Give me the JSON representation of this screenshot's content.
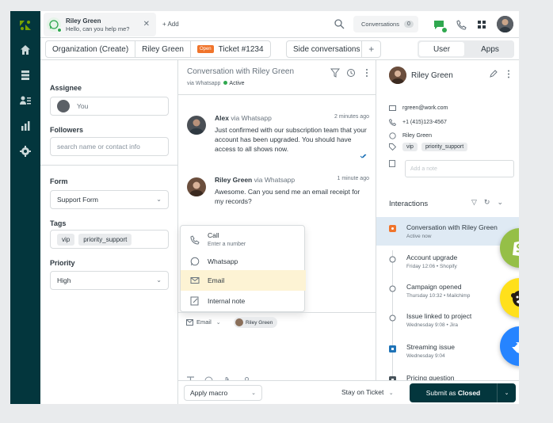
{
  "nav": {
    "items": [
      "home-icon",
      "views-icon",
      "customers-icon",
      "reporting-icon",
      "settings-icon"
    ]
  },
  "topbar": {
    "tab": {
      "name": "Riley Green",
      "preview": "Hello, can you help me?"
    },
    "add_label": "+ Add",
    "conversations_label": "Conversations",
    "conversations_count": "0"
  },
  "row2": {
    "org": "Organization (Create)",
    "requester": "Riley Green",
    "status_badge": "Open",
    "ticket": "Ticket #1234",
    "side_conversations": "Side conversations",
    "plus": "+",
    "user_tab": "User",
    "apps_tab": "Apps"
  },
  "left": {
    "assignee_label": "Assignee",
    "assignee_value": "You",
    "followers_label": "Followers",
    "followers_placeholder": "search name or contact info",
    "form_label": "Form",
    "form_value": "Support Form",
    "tags_label": "Tags",
    "tags": [
      "vip",
      "priority_support"
    ],
    "priority_label": "Priority",
    "priority_value": "High"
  },
  "conversation": {
    "title": "Conversation with Riley Green",
    "via": "via Whatsapp",
    "status": "Active",
    "messages": [
      {
        "name": "Alex",
        "via": "via Whatsapp",
        "time": "2 minutes ago",
        "body": "Just confirmed with our subscription team that your account has been upgraded. You should have access to all shows now."
      },
      {
        "name": "Riley Green",
        "via": "via Whatsapp",
        "time": "1 minute ago",
        "body": "Awesome. Can you send me an email receipt for my records?"
      }
    ],
    "channel_menu": [
      {
        "label": "Call",
        "sub": "Enter a number"
      },
      {
        "label": "Whatsapp",
        "sub": ""
      },
      {
        "label": "Email",
        "sub": ""
      },
      {
        "label": "Internal note",
        "sub": ""
      }
    ],
    "composer_channel": "Email",
    "recipient": "Riley Green"
  },
  "footer": {
    "macro": "Apply macro",
    "stay": "Stay on Ticket",
    "submit_prefix": "Submit as ",
    "submit_status": "Closed"
  },
  "right": {
    "name": "Riley Green",
    "email": "rgreen@work.com",
    "phone": "+1 (415)123-4567",
    "whatsapp": "Riley Green",
    "tags": [
      "vip",
      "priority_support"
    ],
    "note_placeholder": "Add a note",
    "interactions_label": "Interactions",
    "interactions": [
      {
        "title": "Conversation with Riley Green",
        "sub": "Active now",
        "active": true
      },
      {
        "title": "Account upgrade",
        "sub": "Friday 12:06 • Shopify",
        "active": false
      },
      {
        "title": "Campaign opened",
        "sub": "Thursday 10:32 • Mailchimp",
        "active": false
      },
      {
        "title": "Issue linked to project",
        "sub": "Wednesday 9:08 • Jira",
        "active": false
      },
      {
        "title": "Streaming issue",
        "sub": "Wednesday 9:04",
        "active": false
      },
      {
        "title": "Pricing question",
        "sub": "",
        "active": false
      }
    ]
  },
  "colors": {
    "brand": "#03363d",
    "accent_green": "#2fa84f",
    "open_orange": "#f0742b",
    "highlight_blue": "#dfeaf4",
    "menu_highlight": "#fdf3d4"
  },
  "floating_apps": [
    "shopify-icon",
    "mailchimp-icon",
    "jira-icon"
  ]
}
